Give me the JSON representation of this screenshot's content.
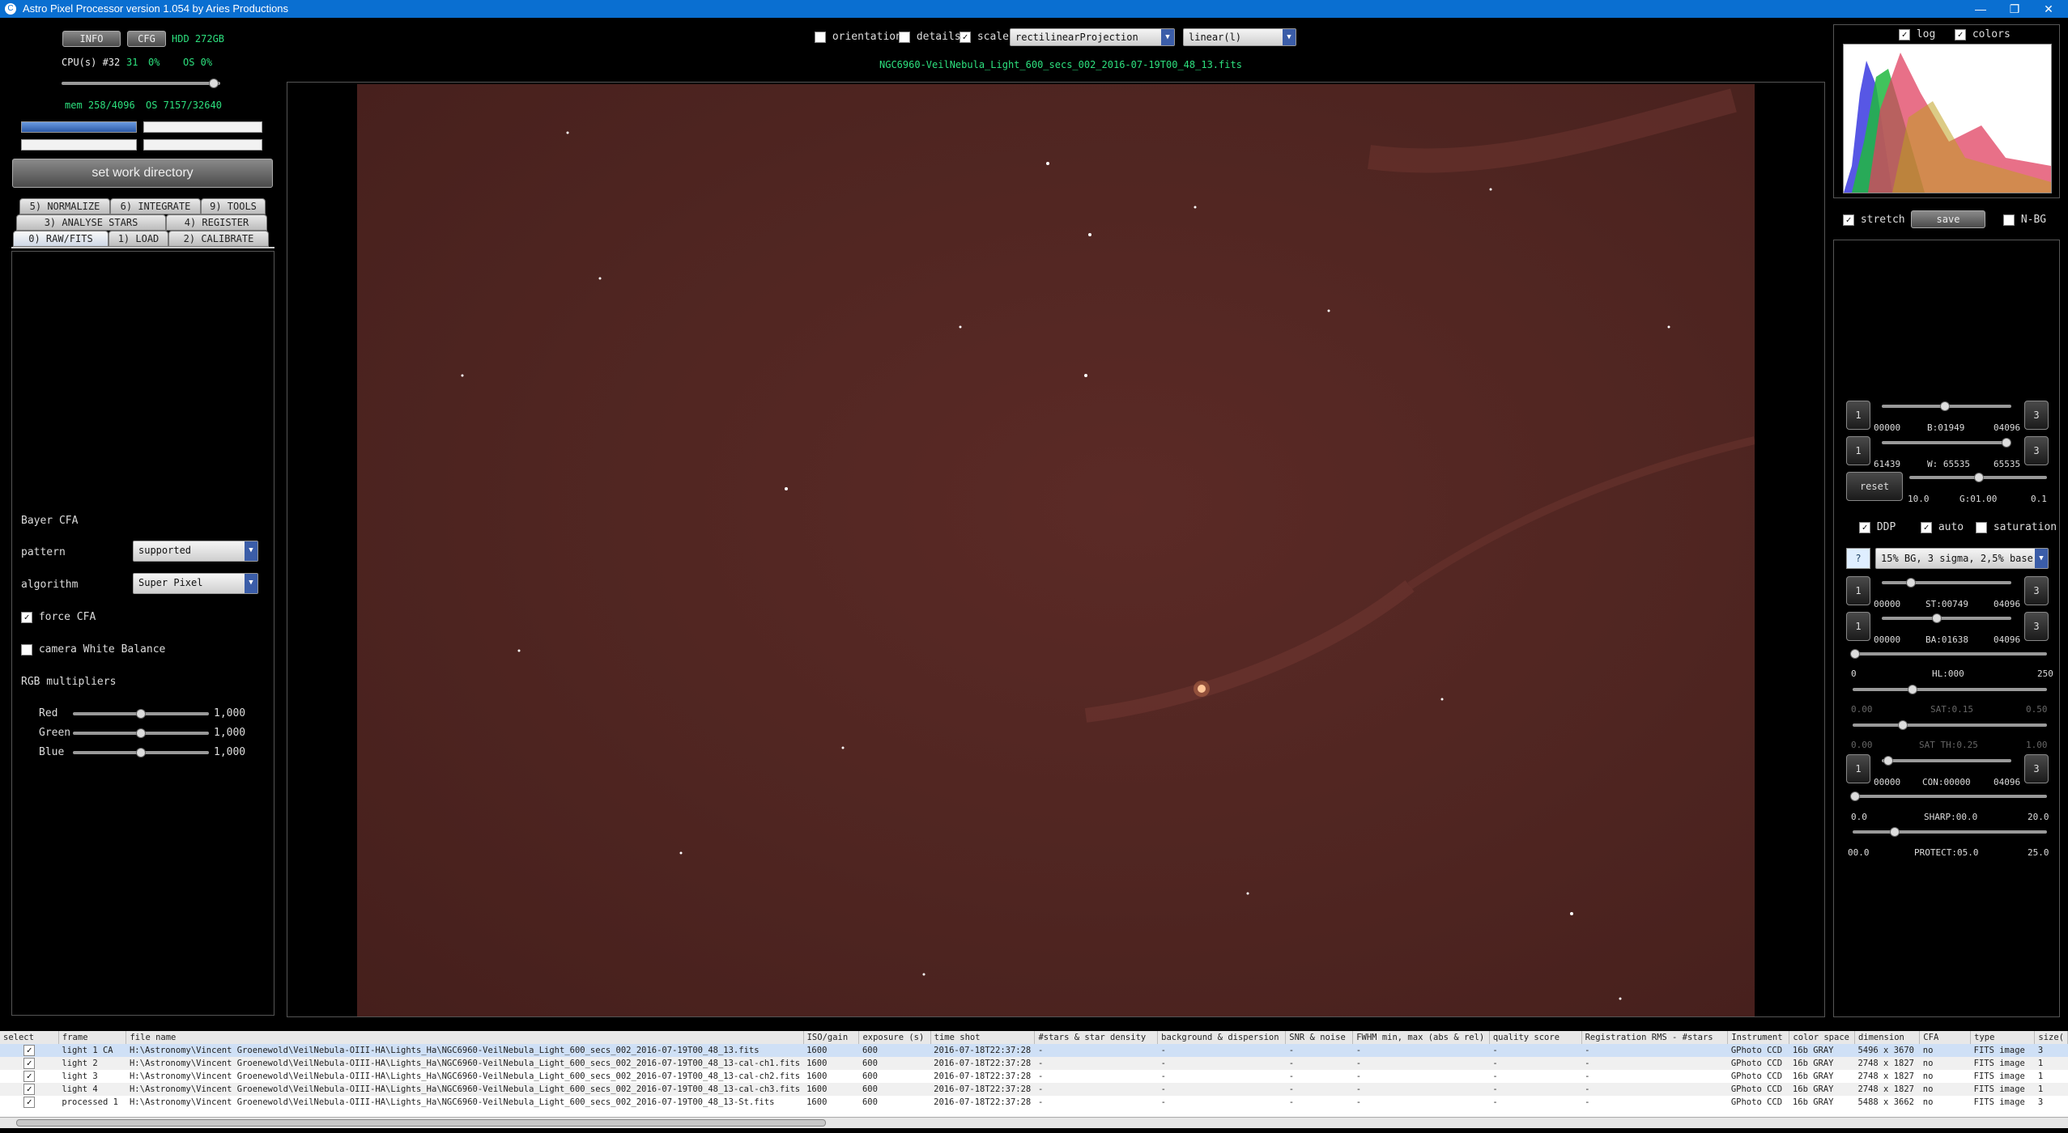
{
  "window": {
    "title": "Astro Pixel Processor version 1.054 by Aries Productions",
    "app_icon": "C"
  },
  "top_left": {
    "info_label": "INFO",
    "cfg_label": "CFG",
    "hdd": "HDD 272GB",
    "cpu_label": "CPU(s) #32",
    "cpu_val1": "31",
    "cpu_val2": "0%",
    "os_pct": "OS 0%",
    "mem": "mem 258/4096",
    "os_mem": "OS 7157/32640",
    "work_dir_label": "set work directory"
  },
  "tabs": {
    "row1": [
      "5) NORMALIZE",
      "6) INTEGRATE",
      "9) TOOLS"
    ],
    "row2": [
      "3) ANALYSE STARS",
      "4) REGISTER"
    ],
    "row3": [
      "0) RAW/FITS",
      "1) LOAD",
      "2) CALIBRATE"
    ]
  },
  "raw_panel": {
    "bayer_cfa": "Bayer CFA",
    "pattern_label": "pattern",
    "pattern_value": "supported",
    "algorithm_label": "algorithm",
    "algorithm_value": "Super Pixel",
    "force_cfa_label": "force CFA",
    "force_cfa_checked": "✓",
    "camera_wb_label": "camera White Balance",
    "rgb_multipliers": "RGB multipliers",
    "red_label": "Red",
    "red_value": "1,000",
    "green_label": "Green",
    "green_value": "1,000",
    "blue_label": "Blue",
    "blue_value": "1,000"
  },
  "viewer": {
    "orientation_label": "orientation",
    "details_label": "details",
    "scale_label": "scale",
    "scale_checked": "✓",
    "projection_value": "rectilinearProjection",
    "stretch_mode_value": "linear(l)",
    "file_title": "NGC6960-VeilNebula_Light_600_secs_002_2016-07-19T00_48_13.fits"
  },
  "histogram": {
    "log_label": "log",
    "colors_label": "colors",
    "log_checked": "✓",
    "colors_checked": "✓"
  },
  "right_panel": {
    "stretch_label": "stretch",
    "stretch_checked": "✓",
    "save_label": "save",
    "nbg_label": "N-BG",
    "b_min": "00000",
    "b_val": "B:01949",
    "b_max": "04096",
    "w_min": "61439",
    "w_val": "W: 65535",
    "w_max": "65535",
    "g_min": "10.0",
    "g_val": "G:01.00",
    "g_max": "0.1",
    "reset_label": "reset",
    "ddp_label": "DDP",
    "ddp_checked": "✓",
    "auto_label": "auto",
    "auto_checked": "✓",
    "saturation_label": "saturation",
    "help_label": "?",
    "preset_value": "15% BG, 3 sigma, 2,5% base",
    "st_min": "00000",
    "st_val": "ST:00749",
    "st_max": "04096",
    "ba_min": "00000",
    "ba_val": "BA:01638",
    "ba_max": "04096",
    "hl_min": "0",
    "hl_val": "HL:000",
    "hl_max": "250",
    "sat_min": "0.00",
    "sat_val": "SAT:0.15",
    "sat_max": "0.50",
    "satth_min": "0.00",
    "satth_val": "SAT TH:0.25",
    "satth_max": "1.00",
    "con_min": "00000",
    "con_val": "CON:00000",
    "con_max": "04096",
    "sharp_min": "0.0",
    "sharp_val": "SHARP:00.0",
    "sharp_max": "20.0",
    "protect_min": "00.0",
    "protect_val": "PROTECT:05.0",
    "protect_max": "25.0",
    "step_left": "1",
    "step_right": "3"
  },
  "file_table": {
    "headers": [
      "select",
      "frame",
      "file name",
      "ISO/gain",
      "exposure (s)",
      "time shot",
      "#stars & star density",
      "background & dispersion",
      "SNR & noise",
      "FWHM min, max (abs & rel)",
      "quality score",
      "Registration RMS - #stars",
      "Instrument",
      "color space",
      "dimension",
      "CFA",
      "type",
      "size("
    ],
    "rows": [
      {
        "check": "✓",
        "frame": "light 1 CA",
        "file": "H:\\Astronomy\\Vincent Groenewold\\VeilNebula-OIII-HA\\Lights_Ha\\NGC6960-VeilNebula_Light_600_secs_002_2016-07-19T00_48_13.fits",
        "iso": "1600",
        "exp": "600",
        "time": "2016-07-18T22:37:28",
        "stars": "-",
        "bg": "-",
        "snr": "-",
        "fwhm": "-",
        "q": "-",
        "reg": "-",
        "inst": "GPhoto CCD",
        "cs": "16b GRAY",
        "dim": "5496 x 3670",
        "cfa": "no",
        "type": "FITS image",
        "size": "3"
      },
      {
        "check": "✓",
        "frame": "light 2",
        "file": "H:\\Astronomy\\Vincent Groenewold\\VeilNebula-OIII-HA\\Lights_Ha\\NGC6960-VeilNebula_Light_600_secs_002_2016-07-19T00_48_13-cal-ch1.fits",
        "iso": "1600",
        "exp": "600",
        "time": "2016-07-18T22:37:28",
        "stars": "-",
        "bg": "-",
        "snr": "-",
        "fwhm": "-",
        "q": "-",
        "reg": "-",
        "inst": "GPhoto CCD",
        "cs": "16b GRAY",
        "dim": "2748 x 1827",
        "cfa": "no",
        "type": "FITS image",
        "size": "1"
      },
      {
        "check": "✓",
        "frame": "light 3",
        "file": "H:\\Astronomy\\Vincent Groenewold\\VeilNebula-OIII-HA\\Lights_Ha\\NGC6960-VeilNebula_Light_600_secs_002_2016-07-19T00_48_13-cal-ch2.fits",
        "iso": "1600",
        "exp": "600",
        "time": "2016-07-18T22:37:28",
        "stars": "-",
        "bg": "-",
        "snr": "-",
        "fwhm": "-",
        "q": "-",
        "reg": "-",
        "inst": "GPhoto CCD",
        "cs": "16b GRAY",
        "dim": "2748 x 1827",
        "cfa": "no",
        "type": "FITS image",
        "size": "1"
      },
      {
        "check": "✓",
        "frame": "light 4",
        "file": "H:\\Astronomy\\Vincent Groenewold\\VeilNebula-OIII-HA\\Lights_Ha\\NGC6960-VeilNebula_Light_600_secs_002_2016-07-19T00_48_13-cal-ch3.fits",
        "iso": "1600",
        "exp": "600",
        "time": "2016-07-18T22:37:28",
        "stars": "-",
        "bg": "-",
        "snr": "-",
        "fwhm": "-",
        "q": "-",
        "reg": "-",
        "inst": "GPhoto CCD",
        "cs": "16b GRAY",
        "dim": "2748 x 1827",
        "cfa": "no",
        "type": "FITS image",
        "size": "1"
      },
      {
        "check": "✓",
        "frame": "processed 1",
        "file": "H:\\Astronomy\\Vincent Groenewold\\VeilNebula-OIII-HA\\Lights_Ha\\NGC6960-VeilNebula_Light_600_secs_002_2016-07-19T00_48_13-St.fits",
        "iso": "1600",
        "exp": "600",
        "time": "2016-07-18T22:37:28",
        "stars": "-",
        "bg": "-",
        "snr": "-",
        "fwhm": "-",
        "q": "-",
        "reg": "-",
        "inst": "GPhoto CCD",
        "cs": "16b GRAY",
        "dim": "5488 x 3662",
        "cfa": "no",
        "type": "FITS image",
        "size": "3"
      }
    ]
  }
}
